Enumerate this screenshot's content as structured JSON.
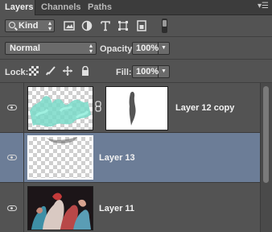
{
  "tabs": [
    {
      "label": "Layers",
      "active": true
    },
    {
      "label": "Channels",
      "active": false
    },
    {
      "label": "Paths",
      "active": false
    }
  ],
  "panel_menu_icon": "panel-menu-icon",
  "filter": {
    "kind_label": "Kind",
    "icons": [
      "image-filter-icon",
      "adjustment-filter-icon",
      "type-filter-icon",
      "shape-filter-icon",
      "smart-object-filter-icon"
    ]
  },
  "blend": {
    "mode": "Normal",
    "opacity_label": "Opacity:",
    "opacity_value": "100%"
  },
  "lock": {
    "label": "Lock:",
    "icons": [
      "lock-transparent-icon",
      "lock-image-icon",
      "lock-position-icon",
      "lock-all-icon"
    ],
    "fill_label": "Fill:",
    "fill_value": "100%"
  },
  "layers": [
    {
      "name": "Layer 12 copy",
      "visible": true,
      "selected": false,
      "has_mask": true
    },
    {
      "name": "Layer 13",
      "visible": true,
      "selected": true,
      "has_mask": false
    },
    {
      "name": "Layer 11",
      "visible": true,
      "selected": false,
      "has_mask": false
    }
  ],
  "colors": {
    "panel_bg": "#535353",
    "selected_row": "#6c7d97",
    "tab_bar": "#3c3c3c"
  }
}
